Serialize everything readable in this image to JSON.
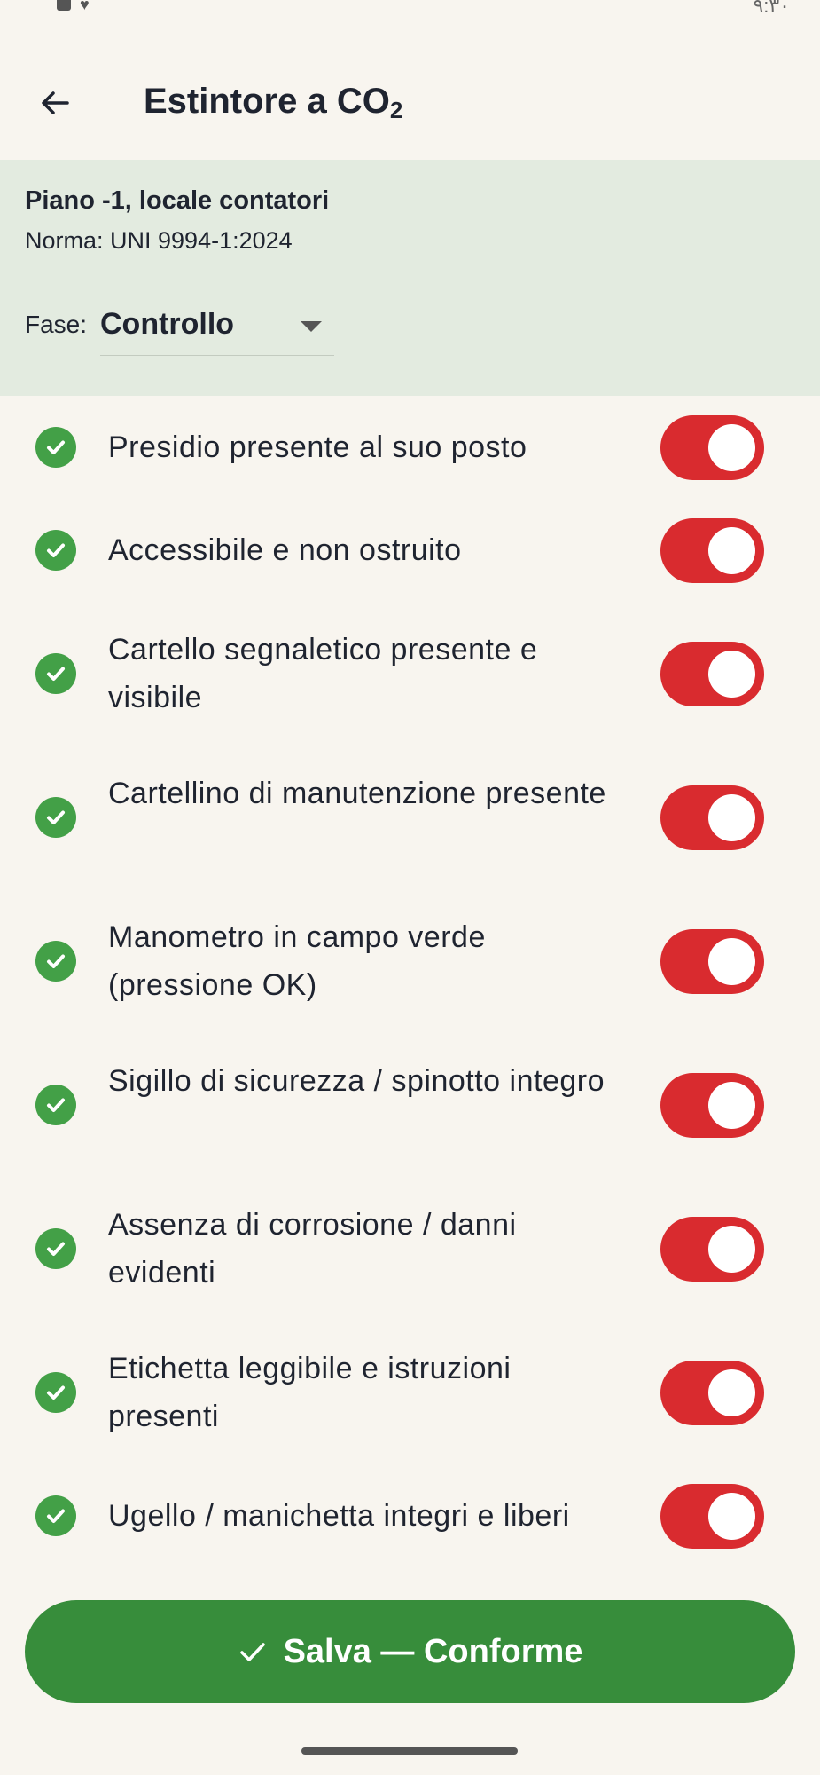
{
  "status_bar": {
    "time": "٩:٣٠"
  },
  "header": {
    "back_icon": "arrow-left-icon",
    "title_main": "Estintore a CO",
    "title_subscript": "2"
  },
  "info": {
    "location": "Piano -1, locale contatori",
    "norma": "Norma: UNI 9994-1:2024",
    "fase_label": "Fase:",
    "fase_value": "Controllo"
  },
  "checklist": [
    {
      "label": "Presidio presente al suo posto",
      "checked": true,
      "toggle_on": true
    },
    {
      "label": "Accessibile e non ostruito",
      "checked": true,
      "toggle_on": true
    },
    {
      "label": "Cartello segnaletico presente e visibile",
      "checked": true,
      "toggle_on": true
    },
    {
      "label": "Cartellino di manutenzione presente",
      "checked": true,
      "toggle_on": true
    },
    {
      "label": "Manometro in campo verde (pressione OK)",
      "checked": true,
      "toggle_on": true
    },
    {
      "label": "Sigillo di sicurezza / spinotto integro",
      "checked": true,
      "toggle_on": true
    },
    {
      "label": "Assenza di corrosione / danni evidenti",
      "checked": true,
      "toggle_on": true
    },
    {
      "label": "Etichetta leggibile e istruzioni presenti",
      "checked": true,
      "toggle_on": true
    },
    {
      "label": "Ugello / manichetta integri e liberi",
      "checked": true,
      "toggle_on": true
    }
  ],
  "footer": {
    "save_label": "Salva — Conforme",
    "save_icon": "check-icon"
  },
  "colors": {
    "background": "#f8f5ef",
    "info_panel": "#e3ebe0",
    "check_green": "#43a047",
    "toggle_red": "#d92b2f",
    "save_green": "#378d3b",
    "text": "#1f2430"
  }
}
